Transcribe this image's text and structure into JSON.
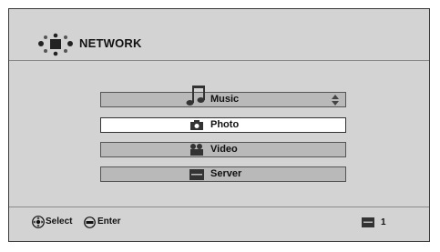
{
  "header": {
    "title": "NETWORK",
    "icon": "network-icon"
  },
  "menu": {
    "items": [
      {
        "label": "Music",
        "icon": "music-note-icon"
      },
      {
        "label": "Photo",
        "icon": "camera-icon"
      },
      {
        "label": "Video",
        "icon": "video-icon"
      },
      {
        "label": "Server",
        "icon": "server-icon"
      }
    ],
    "selected": "Photo"
  },
  "footer": {
    "select_label": "Select",
    "enter_label": "Enter",
    "server_count": "1"
  },
  "colors": {
    "background": "#d3d3d3",
    "item_fill": "#b9b9b9",
    "selected_fill": "#ffffff",
    "icon_dark": "#333333"
  }
}
